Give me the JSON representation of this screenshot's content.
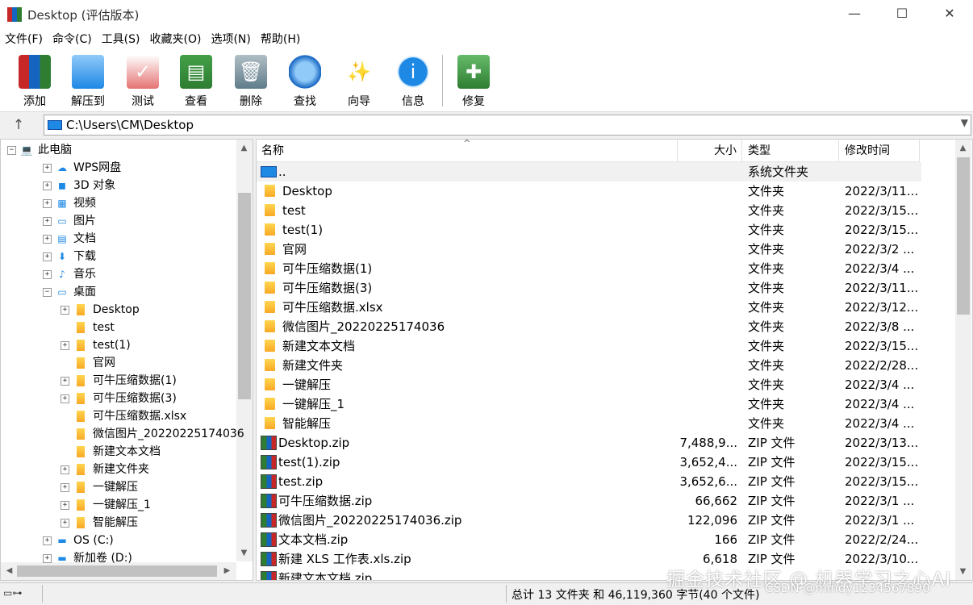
{
  "window": {
    "title": "Desktop (评估版本)"
  },
  "menu": [
    "文件(F)",
    "命令(C)",
    "工具(S)",
    "收藏夹(O)",
    "选项(N)",
    "帮助(H)"
  ],
  "toolbar": [
    {
      "label": "添加",
      "icon": "add-archive-icon"
    },
    {
      "label": "解压到",
      "icon": "extract-to-icon"
    },
    {
      "label": "测试",
      "icon": "test-icon"
    },
    {
      "label": "查看",
      "icon": "view-icon"
    },
    {
      "label": "删除",
      "icon": "delete-icon"
    },
    {
      "label": "查找",
      "icon": "find-icon"
    },
    {
      "label": "向导",
      "icon": "wizard-icon"
    },
    {
      "label": "信息",
      "icon": "info-icon"
    },
    {
      "label": "修复",
      "icon": "repair-icon"
    }
  ],
  "address": {
    "path": "C:\\Users\\CM\\Desktop"
  },
  "tree": [
    {
      "label": "此电脑",
      "level": 0,
      "exp": "-"
    },
    {
      "label": "WPS网盘",
      "level": 1,
      "exp": "+"
    },
    {
      "label": "3D 对象",
      "level": 1,
      "exp": "+"
    },
    {
      "label": "视频",
      "level": 1,
      "exp": "+"
    },
    {
      "label": "图片",
      "level": 1,
      "exp": "+"
    },
    {
      "label": "文档",
      "level": 1,
      "exp": "+"
    },
    {
      "label": "下载",
      "level": 1,
      "exp": "+"
    },
    {
      "label": "音乐",
      "level": 1,
      "exp": "+"
    },
    {
      "label": "桌面",
      "level": 1,
      "exp": "-"
    },
    {
      "label": "Desktop",
      "level": 2,
      "exp": "+"
    },
    {
      "label": "test",
      "level": 2,
      "exp": ""
    },
    {
      "label": "test(1)",
      "level": 2,
      "exp": "+"
    },
    {
      "label": "官网",
      "level": 2,
      "exp": ""
    },
    {
      "label": "可牛压缩数据(1)",
      "level": 2,
      "exp": "+"
    },
    {
      "label": "可牛压缩数据(3)",
      "level": 2,
      "exp": "+"
    },
    {
      "label": "可牛压缩数据.xlsx",
      "level": 2,
      "exp": ""
    },
    {
      "label": "微信图片_20220225174036",
      "level": 2,
      "exp": ""
    },
    {
      "label": "新建文本文档",
      "level": 2,
      "exp": ""
    },
    {
      "label": "新建文件夹",
      "level": 2,
      "exp": "+"
    },
    {
      "label": "一键解压",
      "level": 2,
      "exp": "+"
    },
    {
      "label": "一键解压_1",
      "level": 2,
      "exp": "+"
    },
    {
      "label": "智能解压",
      "level": 2,
      "exp": "+"
    },
    {
      "label": "OS (C:)",
      "level": 1,
      "exp": "+"
    },
    {
      "label": "新加卷 (D:)",
      "level": 1,
      "exp": "+"
    }
  ],
  "columns": {
    "name": "名称",
    "size": "大小",
    "type": "类型",
    "modified": "修改时间"
  },
  "files": [
    {
      "name": "..",
      "size": "",
      "type": "系统文件夹",
      "modified": "",
      "kind": "drive"
    },
    {
      "name": "Desktop",
      "size": "",
      "type": "文件夹",
      "modified": "2022/3/11...",
      "kind": "folder"
    },
    {
      "name": "test",
      "size": "",
      "type": "文件夹",
      "modified": "2022/3/15...",
      "kind": "folder"
    },
    {
      "name": "test(1)",
      "size": "",
      "type": "文件夹",
      "modified": "2022/3/15...",
      "kind": "folder"
    },
    {
      "name": "官网",
      "size": "",
      "type": "文件夹",
      "modified": "2022/3/2 ...",
      "kind": "folder"
    },
    {
      "name": "可牛压缩数据(1)",
      "size": "",
      "type": "文件夹",
      "modified": "2022/3/4 ...",
      "kind": "folder"
    },
    {
      "name": "可牛压缩数据(3)",
      "size": "",
      "type": "文件夹",
      "modified": "2022/3/11...",
      "kind": "folder"
    },
    {
      "name": "可牛压缩数据.xlsx",
      "size": "",
      "type": "文件夹",
      "modified": "2022/3/12...",
      "kind": "folder"
    },
    {
      "name": "微信图片_20220225174036",
      "size": "",
      "type": "文件夹",
      "modified": "2022/3/8 ...",
      "kind": "folder"
    },
    {
      "name": "新建文本文档",
      "size": "",
      "type": "文件夹",
      "modified": "2022/3/15...",
      "kind": "folder"
    },
    {
      "name": "新建文件夹",
      "size": "",
      "type": "文件夹",
      "modified": "2022/2/28...",
      "kind": "folder"
    },
    {
      "name": "一键解压",
      "size": "",
      "type": "文件夹",
      "modified": "2022/3/4 ...",
      "kind": "folder"
    },
    {
      "name": "一键解压_1",
      "size": "",
      "type": "文件夹",
      "modified": "2022/3/4 ...",
      "kind": "folder"
    },
    {
      "name": "智能解压",
      "size": "",
      "type": "文件夹",
      "modified": "2022/3/4 ...",
      "kind": "folder"
    },
    {
      "name": "Desktop.zip",
      "size": "7,488,9...",
      "type": "ZIP 文件",
      "modified": "2022/3/13...",
      "kind": "zip"
    },
    {
      "name": "test(1).zip",
      "size": "3,652,4...",
      "type": "ZIP 文件",
      "modified": "2022/3/15...",
      "kind": "zip"
    },
    {
      "name": "test.zip",
      "size": "3,652,6...",
      "type": "ZIP 文件",
      "modified": "2022/3/15...",
      "kind": "zip"
    },
    {
      "name": "可牛压缩数据.zip",
      "size": "66,662",
      "type": "ZIP 文件",
      "modified": "2022/3/1 ...",
      "kind": "zip"
    },
    {
      "name": "微信图片_20220225174036.zip",
      "size": "122,096",
      "type": "ZIP 文件",
      "modified": "2022/3/1 ...",
      "kind": "zip"
    },
    {
      "name": "文本文档.zip",
      "size": "166",
      "type": "ZIP 文件",
      "modified": "2022/2/24...",
      "kind": "zip"
    },
    {
      "name": "新建 XLS 工作表.xls.zip",
      "size": "6,618",
      "type": "ZIP 文件",
      "modified": "2022/3/10...",
      "kind": "zip"
    },
    {
      "name": "新建文本文档.zip",
      "size": "",
      "type": "",
      "modified": "",
      "kind": "zip"
    }
  ],
  "status": {
    "text": "总计 13 文件夹 和 46,119,360 字节(40 个文件)"
  },
  "watermark": {
    "line1": "掘金技术社区 @ 机器学习之心AI",
    "line2": "CSDN @mindy1234567890"
  }
}
